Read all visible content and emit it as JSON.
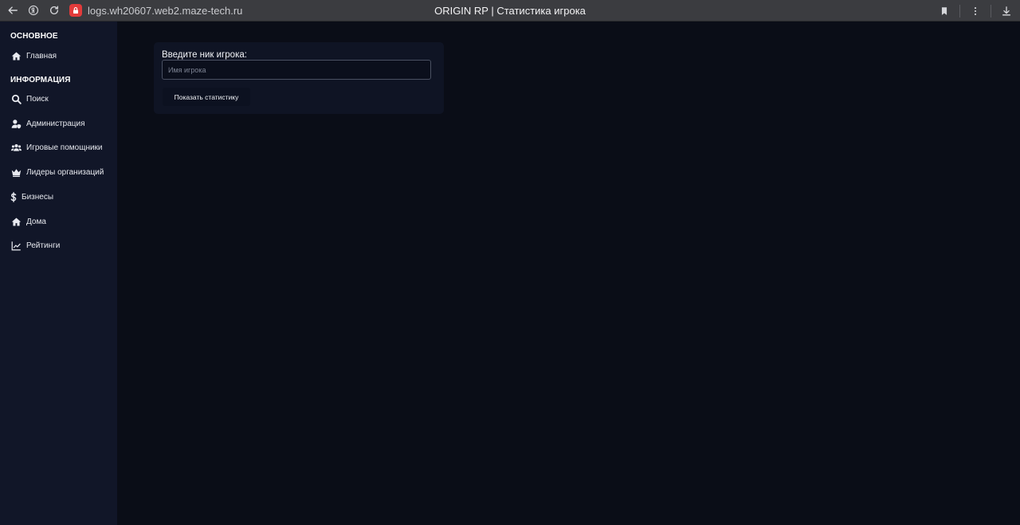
{
  "browser": {
    "url": "logs.wh20607.web2.maze-tech.ru",
    "tab_title": "ORIGIN RP | Статистика игрока",
    "site_badge_color": "#e23b3b"
  },
  "sidebar": {
    "sections": [
      {
        "title": "ОСНОВНОЕ",
        "items": [
          {
            "label": "Главная",
            "icon": "home-icon"
          }
        ]
      },
      {
        "title": "ИНФОРМАЦИЯ",
        "items": [
          {
            "label": "Поиск",
            "icon": "search-icon"
          },
          {
            "label": "Администрация",
            "icon": "user-shield-icon"
          },
          {
            "label": "Игровые помощники",
            "icon": "users-icon"
          },
          {
            "label": "Лидеры организаций",
            "icon": "crown-icon"
          },
          {
            "label": "Бизнесы",
            "icon": "dollar-icon"
          },
          {
            "label": "Дома",
            "icon": "home-icon"
          },
          {
            "label": "Рейтинги",
            "icon": "chart-line-icon"
          }
        ]
      }
    ]
  },
  "main": {
    "prompt_label": "Введите ник игрока:",
    "input_placeholder": "Имя игрока",
    "input_value": "",
    "submit_label": "Показать статистику"
  },
  "colors": {
    "background": "#0a0d17",
    "sidebar": "#111628",
    "card": "#0f1424",
    "browser_bar": "#3b3c40"
  }
}
